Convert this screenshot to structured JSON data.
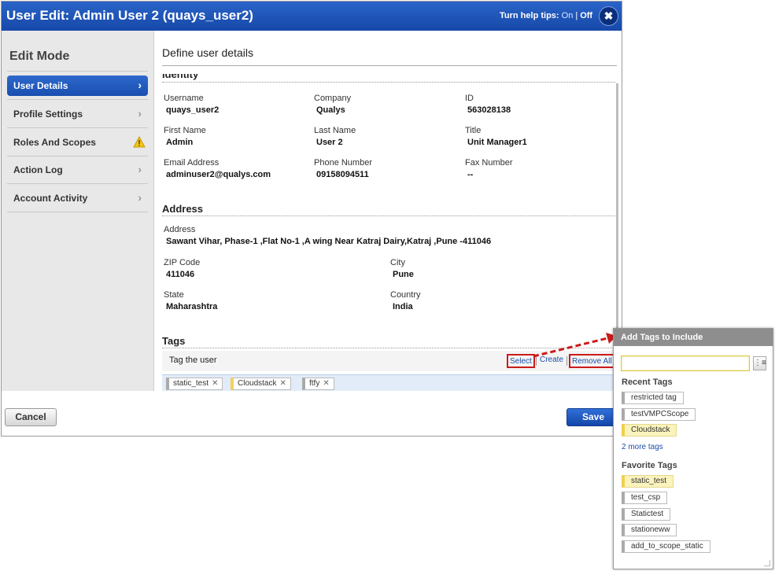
{
  "window": {
    "title": "User Edit: Admin User 2 (quays_user2)",
    "help_tips_label": "Turn help tips:",
    "help_tips_on": "On",
    "help_tips_sep": "|",
    "help_tips_off": "Off",
    "close_glyph": "✖"
  },
  "sidebar": {
    "heading": "Edit Mode",
    "items": [
      {
        "label": "User Details",
        "active": true
      },
      {
        "label": "Profile Settings",
        "active": false
      },
      {
        "label": "Roles And Scopes",
        "active": false,
        "warning": true
      },
      {
        "label": "Action Log",
        "active": false
      },
      {
        "label": "Account Activity",
        "active": false
      }
    ],
    "chevron": "›"
  },
  "main": {
    "heading": "Define user details",
    "identity_section": "Identity",
    "identity": {
      "username_label": "Username",
      "username": "quays_user2",
      "company_label": "Company",
      "company": "Qualys",
      "id_label": "ID",
      "id": "563028138",
      "first_name_label": "First Name",
      "first_name": "Admin",
      "last_name_label": "Last Name",
      "last_name": "User 2",
      "title_label": "Title",
      "title": "Unit Manager1",
      "email_label": "Email Address",
      "email": "adminuser2@qualys.com",
      "phone_label": "Phone Number",
      "phone": "09158094511",
      "fax_label": "Fax Number",
      "fax": "--"
    },
    "address_section": "Address",
    "address": {
      "address_label": "Address",
      "address": "Sawant Vihar, Phase-1 ,Flat No-1 ,A wing Near Katraj Dairy,Katraj ,Pune -411046",
      "zip_label": "ZIP Code",
      "zip": "411046",
      "city_label": "City",
      "city": "Pune",
      "state_label": "State",
      "state": "Maharashtra",
      "country_label": "Country",
      "country": "India"
    },
    "tags_section": "Tags",
    "tags": {
      "tag_the_user": "Tag the user",
      "select": "Select",
      "create": "Create",
      "remove_all": "Remove All",
      "chips": [
        {
          "label": "static_test",
          "color": "#aaaaaa"
        },
        {
          "label": "Cloudstack",
          "color": "#f3d25a"
        },
        {
          "label": "ftfy",
          "color": "#aaaaaa"
        }
      ],
      "remove_glyph": "✕"
    }
  },
  "footer": {
    "cancel": "Cancel",
    "save": "Save"
  },
  "popup": {
    "title": "Add Tags to Include",
    "search_value": "",
    "tree_icon_glyph": "⋮≡",
    "recent_heading": "Recent Tags",
    "recent": [
      {
        "label": "restricted tag",
        "highlight": false
      },
      {
        "label": "testVMPCScope",
        "highlight": false
      },
      {
        "label": "Cloudstack",
        "highlight": true
      }
    ],
    "more_tags": "2 more tags",
    "favorite_heading": "Favorite Tags",
    "favorites": [
      {
        "label": "static_test",
        "highlight": true
      },
      {
        "label": "test_csp",
        "highlight": false
      },
      {
        "label": "Statictest",
        "highlight": false
      },
      {
        "label": "stationeww",
        "highlight": false
      },
      {
        "label": "add_to_scope_static",
        "highlight": false
      }
    ]
  },
  "colors": {
    "title_bar": "#1648a8",
    "active_item": "#1a4fb0",
    "annotation_red": "#cc1a1a",
    "link": "#1d4ea8"
  }
}
